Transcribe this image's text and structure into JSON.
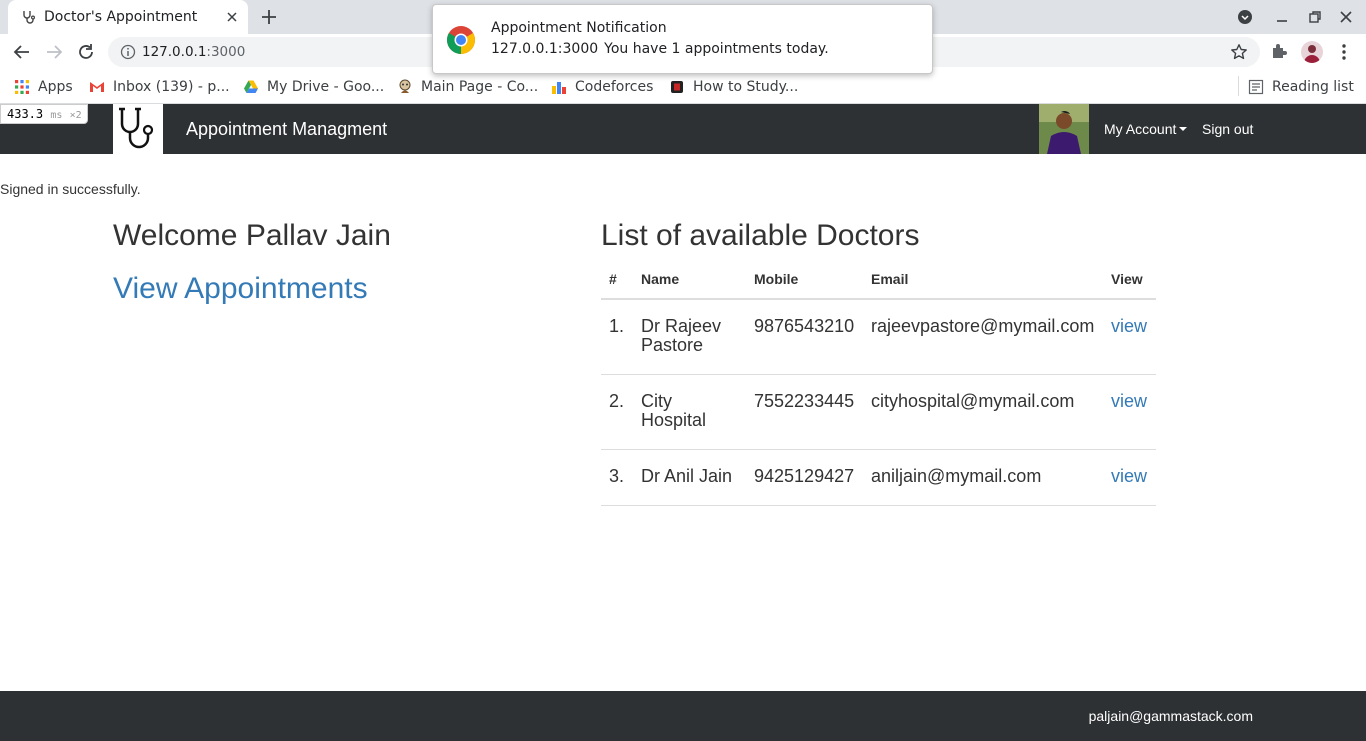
{
  "browser": {
    "tab_title": "Doctor's Appointment",
    "url_host": "127.0.0.1",
    "url_port": ":3000",
    "bookmarks": [
      {
        "label": "Apps",
        "icon": "apps-grid-icon"
      },
      {
        "label": "Inbox (139) - p...",
        "icon": "gmail-icon"
      },
      {
        "label": "My Drive - Goo...",
        "icon": "google-drive-icon"
      },
      {
        "label": "Main Page - Co...",
        "icon": "wiki-icon"
      },
      {
        "label": "Codeforces",
        "icon": "codeforces-icon"
      },
      {
        "label": "How to Study...",
        "icon": "bookmark-red-icon"
      }
    ],
    "reading_list": "Reading list",
    "colors": {
      "tabbar": "#dee1e6",
      "omnibox": "#f1f3f4"
    }
  },
  "perf_badge": {
    "value": "433.3",
    "unit": "ms",
    "multiplier": "×2"
  },
  "notification": {
    "title": "Appointment Notification",
    "origin": "127.0.0.1:3000",
    "message": "You have 1 appointments today."
  },
  "navbar": {
    "brand": "Appointment Managment",
    "account": "My Account",
    "signout": "Sign out",
    "bg_color": "#2d3133"
  },
  "flash": "Signed in successfully.",
  "main": {
    "welcome": "Welcome Pallav Jain",
    "view_appointments": "View Appointments",
    "list_title": "List of available Doctors",
    "columns": [
      "#",
      "Name",
      "Mobile",
      "Email",
      "View"
    ],
    "doctors": [
      {
        "num": "1.",
        "name": "Dr Rajeev Pastore",
        "mobile": "9876543210",
        "email": "rajeevpastore@mymail.com",
        "view": "view"
      },
      {
        "num": "2.",
        "name": "City Hospital",
        "mobile": "7552233445",
        "email": "cityhospital@mymail.com",
        "view": "view"
      },
      {
        "num": "3.",
        "name": "Dr Anil Jain",
        "mobile": "9425129427",
        "email": "aniljain@mymail.com",
        "view": "view"
      }
    ],
    "link_color": "#337ab7"
  },
  "footer": {
    "email": "paljain@gammastack.com"
  }
}
